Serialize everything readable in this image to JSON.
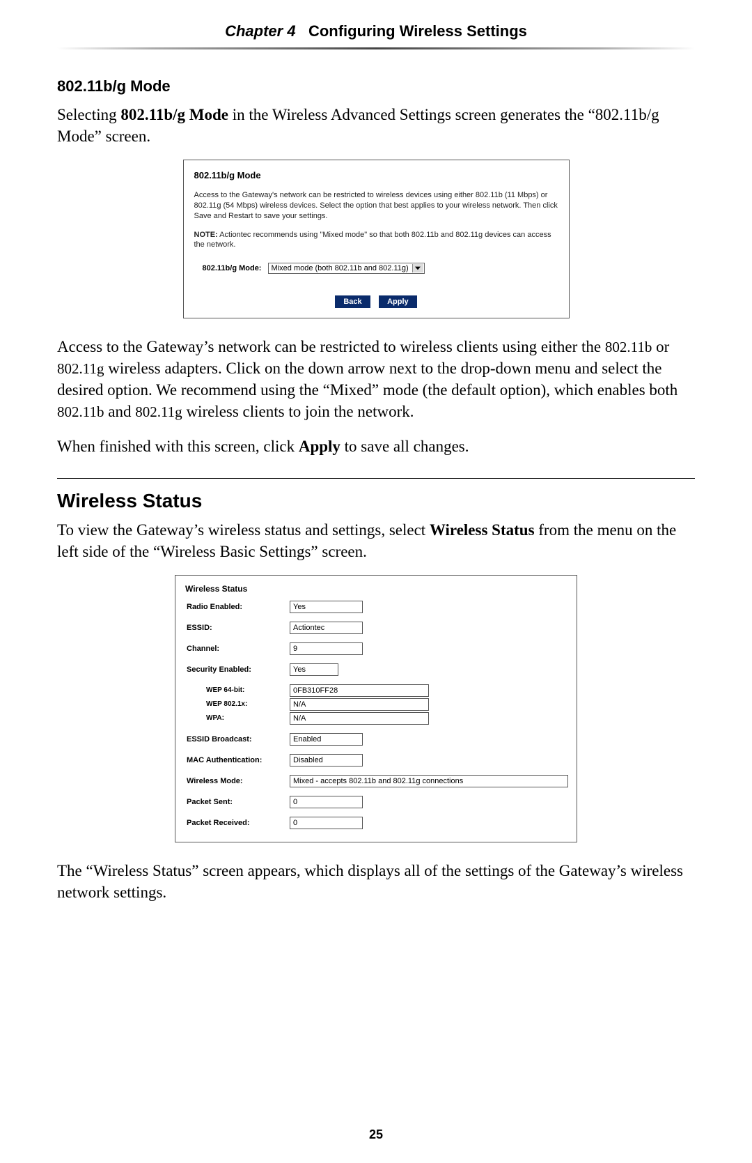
{
  "chapter": {
    "prefix": "Chapter 4",
    "title": "Configuring Wireless Settings"
  },
  "section1": {
    "subtitle": "802.11b/g Mode",
    "intro_a": "Selecting ",
    "intro_b": "802.11b/g Mode",
    "intro_c": " in the Wireless Advanced Settings screen generates the “802.11b/g Mode” screen."
  },
  "panel1": {
    "title": "802.11b/g Mode",
    "body": "Access to the Gateway's network can be restricted to wireless devices using either 802.11b (11 Mbps) or 802.11g (54 Mbps) wireless devices. Select the option that best applies to your wireless network. Then click Save and Restart to save your settings.",
    "note_prefix": "NOTE:",
    "note_body": " Actiontec recommends using \"Mixed mode\" so that both 802.11b and 802.11g devices can access the network.",
    "mode_label": "802.11b/g Mode:",
    "mode_value": "Mixed mode (both 802.11b and 802.11g)",
    "back": "Back",
    "apply": "Apply"
  },
  "para2_a": "Access to the Gateway’s network can be restricted to wireless clients using either the ",
  "para2_b": "802.11b",
  "para2_c": " or ",
  "para2_d": "802.11g",
  "para2_e": " wireless adapters. Click on the down arrow next to the drop-down menu and select the desired option. We recommend using the “Mixed” mode (the default option), which enables both ",
  "para2_f": "802.11b",
  "para2_g": " and ",
  "para2_h": "802.11g",
  "para2_i": " wireless clients to join the network.",
  "para3_a": "When finished with this screen, click ",
  "para3_b": "Apply",
  "para3_c": " to save all changes.",
  "section2": {
    "title": "Wireless Status",
    "intro_a": "To view the Gateway’s wireless status and settings, select ",
    "intro_b": "Wireless Status",
    "intro_c": " from the menu on the left side of the “Wireless Basic Settings” screen."
  },
  "panel2": {
    "title": "Wireless Status",
    "rows": {
      "radio": {
        "label": "Radio Enabled:",
        "value": "Yes"
      },
      "essid": {
        "label": "ESSID:",
        "value": "Actiontec"
      },
      "channel": {
        "label": "Channel:",
        "value": "9"
      },
      "security": {
        "label": "Security Enabled:",
        "value": "Yes"
      },
      "wep64": {
        "label": "WEP 64-bit:",
        "value": "0FB310FF28"
      },
      "wep8021x": {
        "label": "WEP 802.1x:",
        "value": "N/A"
      },
      "wpa": {
        "label": "WPA:",
        "value": "N/A"
      },
      "broadcast": {
        "label": "ESSID Broadcast:",
        "value": "Enabled"
      },
      "macauth": {
        "label": "MAC Authentication:",
        "value": "Disabled"
      },
      "mode": {
        "label": "Wireless Mode:",
        "value": "Mixed - accepts 802.11b and 802.11g connections"
      },
      "sent": {
        "label": "Packet Sent:",
        "value": "0"
      },
      "recv": {
        "label": "Packet Received:",
        "value": "0"
      }
    }
  },
  "para4": "The “Wireless Status” screen appears, which displays all of the settings of the Gateway’s wireless network settings.",
  "page_number": "25"
}
